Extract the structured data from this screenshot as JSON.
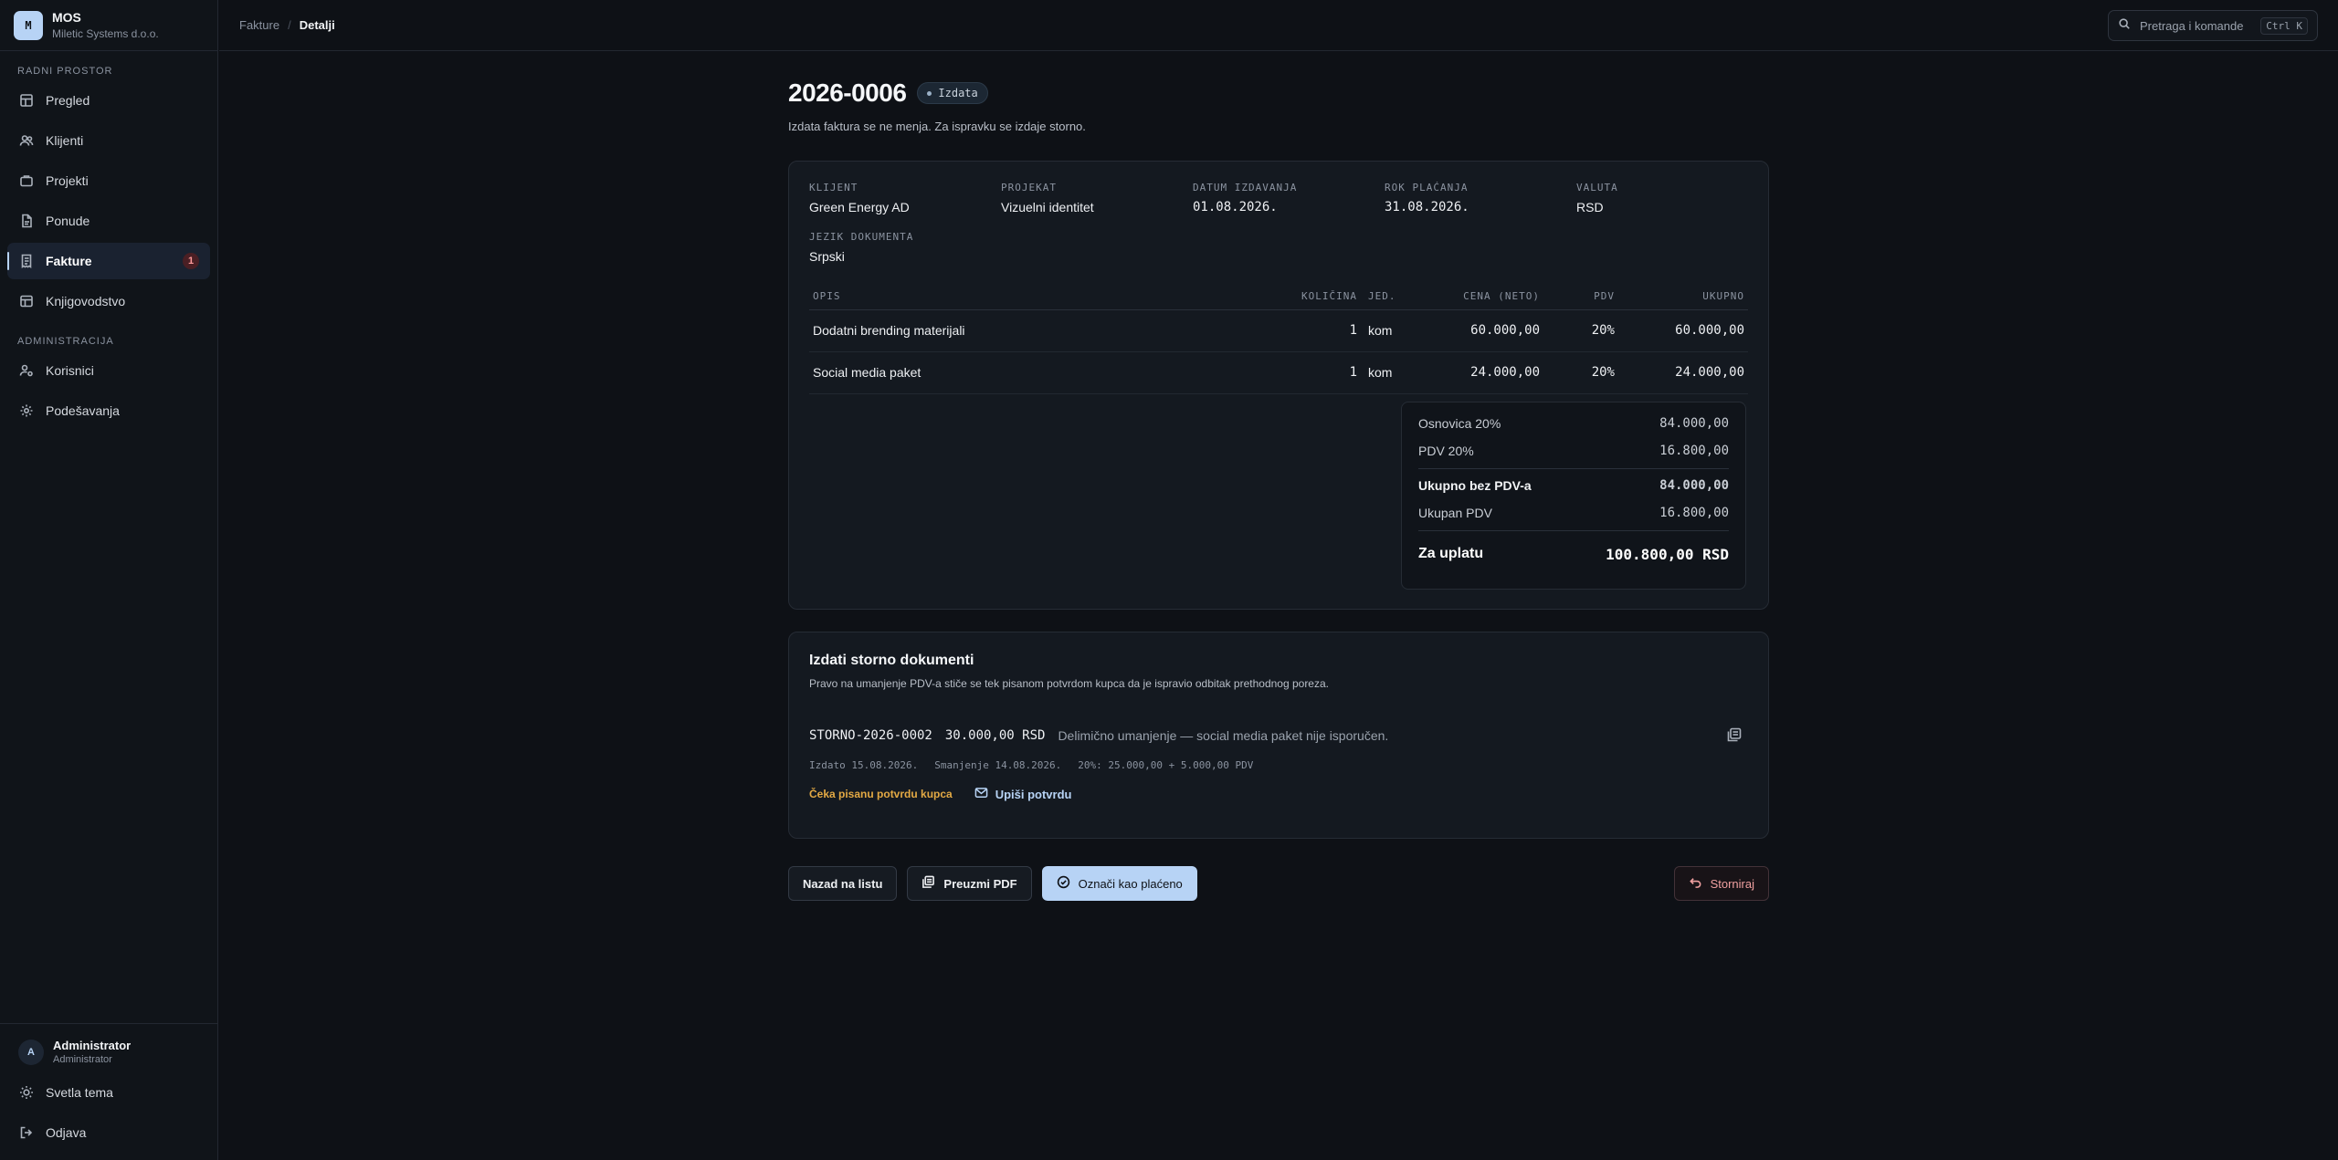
{
  "brand": {
    "logo": "M",
    "name": "MOS",
    "company": "Miletic Systems d.o.o."
  },
  "sidebar": {
    "section_workspace": "RADNI PROSTOR",
    "section_admin": "ADMINISTRACIJA",
    "items": [
      {
        "label": "Pregled",
        "icon": "layout-icon"
      },
      {
        "label": "Klijenti",
        "icon": "users-icon"
      },
      {
        "label": "Projekti",
        "icon": "briefcase-icon"
      },
      {
        "label": "Ponude",
        "icon": "file-icon"
      },
      {
        "label": "Fakture",
        "icon": "receipt-icon",
        "badge": "1",
        "active": true
      },
      {
        "label": "Knjigovodstvo",
        "icon": "table-icon"
      }
    ],
    "admin_items": [
      {
        "label": "Korisnici",
        "icon": "user-gear-icon"
      },
      {
        "label": "Podešavanja",
        "icon": "gear-icon"
      }
    ],
    "user": {
      "initial": "A",
      "name": "Administrator",
      "role": "Administrator"
    },
    "theme_label": "Svetla tema",
    "logout_label": "Odjava"
  },
  "topbar": {
    "breadcrumb_parent": "Fakture",
    "breadcrumb_current": "Detalji",
    "search_placeholder": "Pretraga i komande",
    "search_shortcut": "Ctrl K"
  },
  "invoice": {
    "number": "2026-0006",
    "status": "Izdata",
    "note": "Izdata faktura se ne menja. Za ispravku se izdaje storno.",
    "meta": {
      "client_label": "KLIJENT",
      "client": "Green Energy AD",
      "project_label": "PROJEKAT",
      "project": "Vizuelni identitet",
      "issue_date_label": "DATUM IZDAVANJA",
      "issue_date": "01.08.2026.",
      "due_date_label": "ROK PLAĆANJA",
      "due_date": "31.08.2026.",
      "currency_label": "VALUTA",
      "currency": "RSD",
      "language_label": "JEZIK DOKUMENTA",
      "language": "Srpski"
    },
    "columns": {
      "desc": "OPIS",
      "qty": "KOLIČINA",
      "unit": "JED.",
      "price": "CENA (NETO)",
      "vat": "PDV",
      "total": "UKUPNO"
    },
    "rows": [
      {
        "desc": "Dodatni brending materijali",
        "qty": "1",
        "unit": "kom",
        "price": "60.000,00",
        "vat": "20%",
        "total": "60.000,00"
      },
      {
        "desc": "Social media paket",
        "qty": "1",
        "unit": "kom",
        "price": "24.000,00",
        "vat": "20%",
        "total": "24.000,00"
      }
    ],
    "totals": {
      "base_label": "Osnovica 20%",
      "base": "84.000,00",
      "vat_label": "PDV 20%",
      "vat": "16.800,00",
      "net_label": "Ukupno bez PDV-a",
      "net": "84.000,00",
      "vat_total_label": "Ukupan PDV",
      "vat_total": "16.800,00",
      "due_label": "Za uplatu",
      "due": "100.800,00 RSD"
    }
  },
  "storno": {
    "title": "Izdati storno dokumenti",
    "description": "Pravo na umanjenje PDV-a stiče se tek pisanom potvrdom kupca da je ispravio odbitak prethodnog poreza.",
    "number": "STORNO-2026-0002",
    "amount": "30.000,00 RSD",
    "note": "Delimično umanjenje — social media paket nije isporučen.",
    "issued": "Izdato 15.08.2026.",
    "reduction": "Smanjenje 14.08.2026.",
    "breakdown": "20%: 25.000,00 + 5.000,00 PDV",
    "status": "Čeka pisanu potvrdu kupca",
    "confirm_label": "Upiši potvrdu"
  },
  "actions": {
    "back": "Nazad na listu",
    "pdf": "Preuzmi PDF",
    "mark_paid": "Označi kao plaćeno",
    "storno": "Storniraj"
  }
}
